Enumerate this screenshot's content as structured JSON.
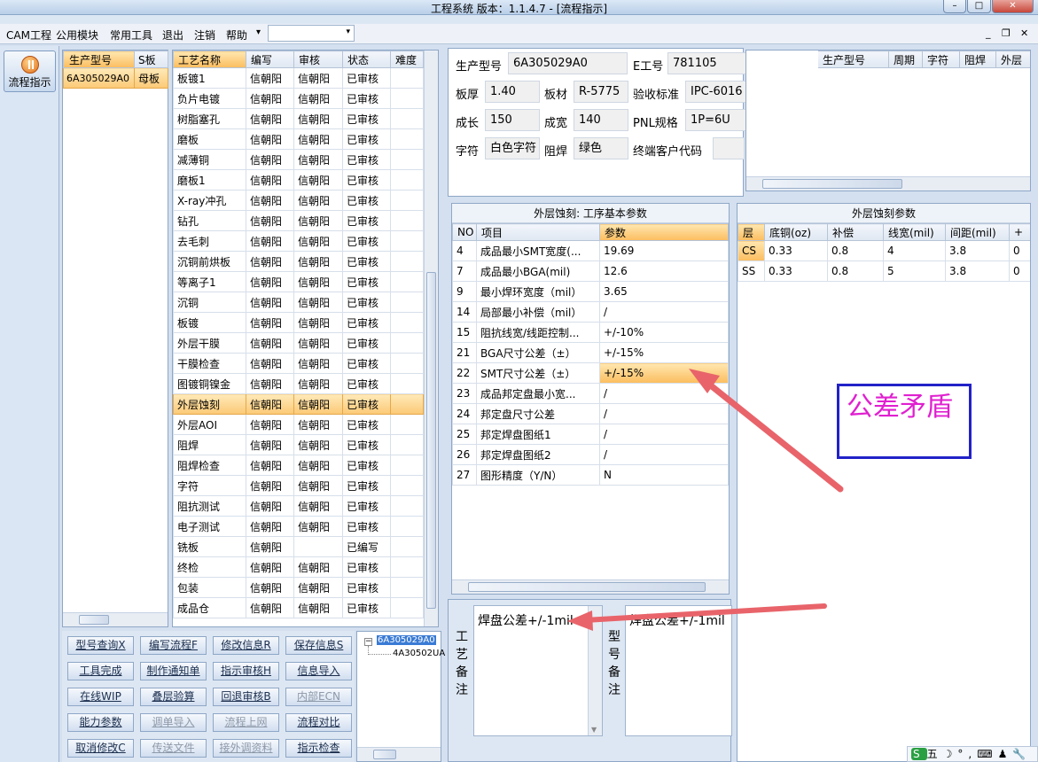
{
  "window": {
    "title": "工程系统  版本：1.1.4.7 - [流程指示]",
    "min": "–",
    "max": "□",
    "close": "✕"
  },
  "menu": {
    "items": [
      "CAM工程",
      "公用模块",
      "常用工具",
      "退出",
      "注销",
      "帮助"
    ],
    "dropdown_arrow": "▾",
    "mdi_buttons": [
      "_",
      "❐",
      "✕"
    ]
  },
  "nav": {
    "button_label": "流程指示"
  },
  "product_list": {
    "headers": [
      "生产型号",
      "S板"
    ],
    "rows": [
      [
        "6A305029A0",
        "母板"
      ]
    ]
  },
  "process_table": {
    "headers": [
      "工艺名称",
      "编写",
      "审核",
      "状态",
      "难度"
    ],
    "rows": [
      [
        "板镀1",
        "信朝阳",
        "信朝阳",
        "已审核"
      ],
      [
        "负片电镀",
        "信朝阳",
        "信朝阳",
        "已审核"
      ],
      [
        "树脂塞孔",
        "信朝阳",
        "信朝阳",
        "已审核"
      ],
      [
        "磨板",
        "信朝阳",
        "信朝阳",
        "已审核"
      ],
      [
        "减薄铜",
        "信朝阳",
        "信朝阳",
        "已审核"
      ],
      [
        "磨板1",
        "信朝阳",
        "信朝阳",
        "已审核"
      ],
      [
        "X-ray冲孔",
        "信朝阳",
        "信朝阳",
        "已审核"
      ],
      [
        "钻孔",
        "信朝阳",
        "信朝阳",
        "已审核"
      ],
      [
        "去毛刺",
        "信朝阳",
        "信朝阳",
        "已审核"
      ],
      [
        "沉铜前烘板",
        "信朝阳",
        "信朝阳",
        "已审核"
      ],
      [
        "等离子1",
        "信朝阳",
        "信朝阳",
        "已审核"
      ],
      [
        "沉铜",
        "信朝阳",
        "信朝阳",
        "已审核"
      ],
      [
        "板镀",
        "信朝阳",
        "信朝阳",
        "已审核"
      ],
      [
        "外层干膜",
        "信朝阳",
        "信朝阳",
        "已审核"
      ],
      [
        "干膜检查",
        "信朝阳",
        "信朝阳",
        "已审核"
      ],
      [
        "图镀铜镍金",
        "信朝阳",
        "信朝阳",
        "已审核"
      ],
      [
        "外层蚀刻",
        "信朝阳",
        "信朝阳",
        "已审核"
      ],
      [
        "外层AOI",
        "信朝阳",
        "信朝阳",
        "已审核"
      ],
      [
        "阻焊",
        "信朝阳",
        "信朝阳",
        "已审核"
      ],
      [
        "阻焊检查",
        "信朝阳",
        "信朝阳",
        "已审核"
      ],
      [
        "字符",
        "信朝阳",
        "信朝阳",
        "已审核"
      ],
      [
        "阻抗测试",
        "信朝阳",
        "信朝阳",
        "已审核"
      ],
      [
        "电子测试",
        "信朝阳",
        "信朝阳",
        "已审核"
      ],
      [
        "铣板",
        "信朝阳",
        "",
        "已编写"
      ],
      [
        "终检",
        "信朝阳",
        "信朝阳",
        "已审核"
      ],
      [
        "包装",
        "信朝阳",
        "信朝阳",
        "已审核"
      ],
      [
        "成品仓",
        "信朝阳",
        "信朝阳",
        "已审核"
      ]
    ],
    "selected_index": 16
  },
  "buttons": [
    [
      "型号查询X",
      "编写流程F",
      "修改信息R",
      "保存信息S"
    ],
    [
      "工具完成",
      "制作通知单",
      "指示审核H",
      "信息导入"
    ],
    [
      "在线WIP",
      "叠层验算",
      "回退审核B",
      "内部ECN"
    ],
    [
      "能力参数",
      "调单导入",
      "流程上网",
      "流程对比"
    ],
    [
      "取消修改C",
      "传送文件",
      "接外调资料",
      "指示检查"
    ]
  ],
  "disabled_buttons": [
    "内部ECN",
    "调单导入",
    "流程上网",
    "传送文件",
    "接外调资料"
  ],
  "tree": {
    "root": "6A305029A0",
    "child": "4A30502UA"
  },
  "info": {
    "labels": {
      "model": "生产型号",
      "eno": "E工号",
      "thick": "板厚",
      "material": "板材",
      "std": "验收标准",
      "len": "成长",
      "wid": "成宽",
      "pnl": "PNL规格",
      "char": "字符",
      "mask": "阻焊",
      "cust": "终端客户代码"
    },
    "values": {
      "model": "6A305029A0",
      "eno": "781105",
      "thick": "1.40",
      "material": "R-5775",
      "std": "IPC-6016",
      "len": "150",
      "wid": "140",
      "pnl": "1P=6U",
      "char": "白色字符",
      "mask": "绿色",
      "cust": ""
    }
  },
  "right_grid": {
    "headers": [
      "生产型号",
      "周期",
      "字符",
      "阻焊",
      "外层"
    ]
  },
  "process_params": {
    "title": "外层蚀刻: 工序基本参数",
    "headers": [
      "NO",
      "项目",
      "参数"
    ],
    "rows": [
      [
        "4",
        "成品最小SMT宽度(...",
        "19.69"
      ],
      [
        "7",
        "成品最小BGA(mil)",
        "12.6"
      ],
      [
        "9",
        "最小焊环宽度（mil）",
        "3.65"
      ],
      [
        "14",
        "局部最小补偿（mil）",
        "/"
      ],
      [
        "15",
        "阻抗线宽/线距控制...",
        "+/-10%"
      ],
      [
        "21",
        "BGA尺寸公差（±）",
        "+/-15%"
      ],
      [
        "22",
        "SMT尺寸公差（±）",
        "+/-15%"
      ],
      [
        "23",
        "成品邦定盘最小宽...",
        "/"
      ],
      [
        "24",
        "邦定盘尺寸公差",
        "/"
      ],
      [
        "25",
        "邦定焊盘图纸1",
        "/"
      ],
      [
        "26",
        "邦定焊盘图纸2",
        "/"
      ],
      [
        "27",
        "图形精度（Y/N）",
        "N"
      ]
    ],
    "highlight_index": 6
  },
  "etch_params": {
    "title": "外层蚀刻参数",
    "headers": [
      "层",
      "底铜(oz)",
      "补偿",
      "线宽(mil)",
      "间距(mil)",
      "+"
    ],
    "rows": [
      [
        "CS",
        "0.33",
        "0.8",
        "4",
        "3.8",
        "0"
      ],
      [
        "SS",
        "0.33",
        "0.8",
        "5",
        "3.8",
        "0"
      ]
    ]
  },
  "notes": {
    "process_label": "工艺备注",
    "process_text": "焊盘公差+/-1mil",
    "model_label": "型号备注",
    "model_text": "焊盘公差+/-1mil"
  },
  "annotation": {
    "text": "公差矛盾",
    "color": "#e020d0",
    "arrow_color": "#e8646a"
  },
  "tray": {
    "items": [
      "S",
      "五",
      "☽",
      "°,",
      "⌨",
      "♟",
      "🔧"
    ]
  }
}
